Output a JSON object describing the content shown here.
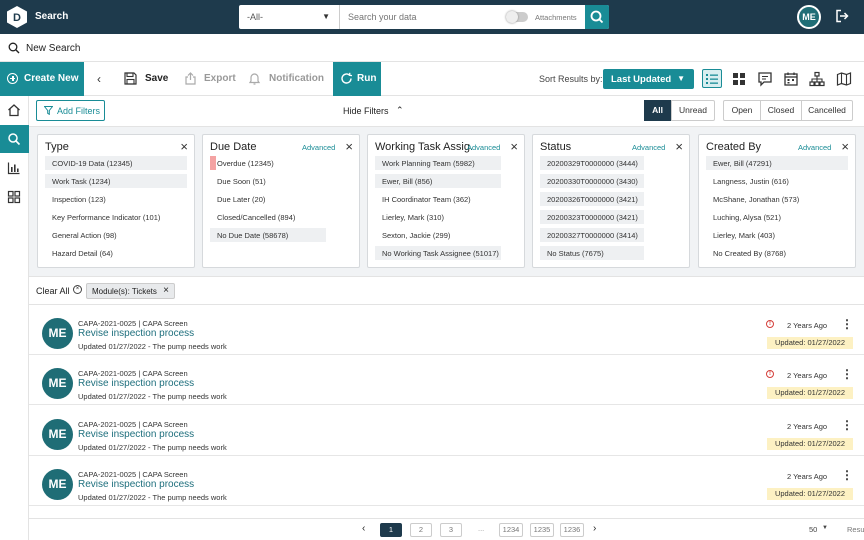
{
  "app": {
    "title": "Search",
    "user_initials": "ME"
  },
  "search": {
    "scope_value": "-All-",
    "placeholder": "Search your data",
    "attachments_label": "Attachments"
  },
  "new_search": {
    "label": "New Search"
  },
  "toolbar": {
    "create_new": "Create New",
    "save": "Save",
    "export": "Export",
    "notification": "Notification",
    "run": "Run",
    "sort_label": "Sort Results by:",
    "sort_value": "Last Updated"
  },
  "filterbar": {
    "add_filters": "Add Filters",
    "hide_filters": "Hide Filters",
    "read_segments": [
      "All",
      "Unread"
    ],
    "status_segments": [
      "Open",
      "Closed",
      "Cancelled"
    ]
  },
  "panels": [
    {
      "title": "Type",
      "advanced": "",
      "items": [
        "COVID-19 Data (12345)",
        "Work Task (1234)",
        "Inspection (123)",
        "Key Performance Indicator (101)",
        "General Action (98)",
        "Hazard Detail (64)"
      ]
    },
    {
      "title": "Due Date",
      "advanced": "Advanced",
      "items": [
        "Overdue (12345)",
        "Due Soon (51)",
        "Due Later (20)",
        "Closed/Cancelled (894)",
        "No Due Date (58678)"
      ]
    },
    {
      "title": "Working Task Assig...",
      "advanced": "Advanced",
      "items": [
        "Work Planning Team (5982)",
        "Ewer, Bill (856)",
        "IH Coordinator Team (362)",
        "Lierley, Mark (310)",
        "Sexton, Jackie (299)",
        "No Working Task Assignee (51017)"
      ]
    },
    {
      "title": "Status",
      "advanced": "Advanced",
      "items": [
        "20200329T0000000 (3444)",
        "20200330T0000000 (3430)",
        "20200326T0000000 (3421)",
        "20200323T0000000 (3421)",
        "20200327T0000000 (3414)",
        "No Status (7675)"
      ]
    },
    {
      "title": "Created By",
      "advanced": "Advanced",
      "items": [
        "Ewer, Bill (47291)",
        "Langness, Justin (616)",
        "McShane, Jonathan (573)",
        "Luching, Alysa (521)",
        "Lierley, Mark (403)",
        "No Created By (8768)"
      ]
    }
  ],
  "chips": {
    "clear_all": "Clear All",
    "active": [
      "Module(s): Tickets"
    ]
  },
  "results": [
    {
      "initials": "ME",
      "meta": "CAPA-2021-0025 | CAPA Screen",
      "title": "Revise inspection process",
      "updated": "Updated 01/27/2022 - The pump needs work",
      "ago": "2 Years Ago",
      "badge": "Updated: 01/27/2022",
      "alert": "!"
    },
    {
      "initials": "ME",
      "meta": "CAPA-2021-0025 | CAPA Screen",
      "title": "Revise inspection process",
      "updated": "Updated 01/27/2022 - The pump needs work",
      "ago": "2 Years Ago",
      "badge": "Updated: 01/27/2022",
      "alert": "!"
    },
    {
      "initials": "ME",
      "meta": "CAPA-2021-0025 | CAPA Screen",
      "title": "Revise inspection process",
      "updated": "Updated 01/27/2022 - The pump needs work",
      "ago": "2 Years Ago",
      "badge": "Updated: 01/27/2022",
      "alert": ""
    },
    {
      "initials": "ME",
      "meta": "CAPA-2021-0025 | CAPA Screen",
      "title": "Revise inspection process",
      "updated": "Updated 01/27/2022 - The pump needs work",
      "ago": "2 Years Ago",
      "badge": "Updated: 01/27/2022",
      "alert": ""
    }
  ],
  "pagination": {
    "pages": [
      "1",
      "2",
      "3",
      "...",
      "1234",
      "1235",
      "1236"
    ],
    "current": "1",
    "per_page": "50",
    "results_label": "Resu"
  },
  "colors": {
    "header_bg": "#1e3a4c",
    "accent": "#198c96",
    "badge_bg": "#fdf1c3",
    "overdue_mark": "#f4a3a3"
  }
}
